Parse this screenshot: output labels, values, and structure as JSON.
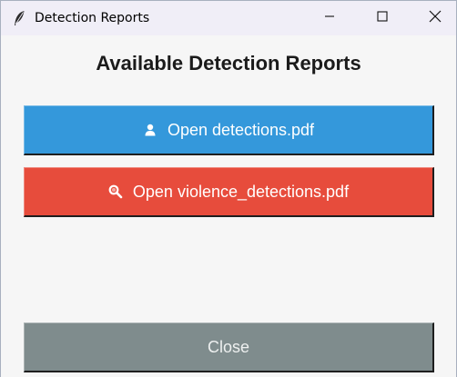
{
  "window": {
    "title": "Detection Reports",
    "app_icon": "feather-icon"
  },
  "window_controls": {
    "minimize_icon": "minimize-icon",
    "maximize_icon": "maximize-icon",
    "close_icon": "close-icon"
  },
  "main": {
    "heading": "Available Detection Reports",
    "buttons": [
      {
        "label": "Open detections.pdf",
        "icon": "person-icon",
        "color": "#3498db"
      },
      {
        "label": "Open violence_detections.pdf",
        "icon": "magnifier-icon",
        "color": "#e74c3c"
      }
    ],
    "close_label": "Close",
    "close_color": "#7f8c8d"
  }
}
